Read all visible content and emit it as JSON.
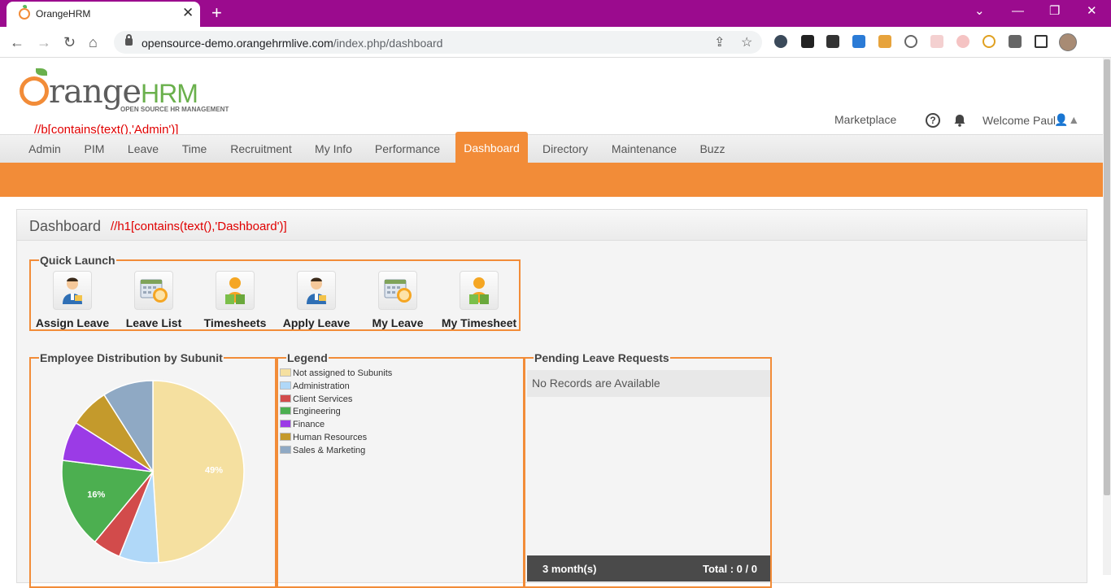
{
  "browser": {
    "tab_title": "OrangeHRM",
    "url_host": "opensource-demo.orangehrmlive.com",
    "url_path": "/index.php/dashboard",
    "tab_close": "✕",
    "new_tab": "+",
    "window_controls": {
      "chevron": "⌄",
      "minimize": "—",
      "restore": "❐",
      "close": "✕"
    },
    "nav_icons": {
      "back": "←",
      "forward": "→",
      "reload": "↻",
      "home": "⌂"
    },
    "url_icons": {
      "share": "⇪",
      "bookmark": "☆"
    }
  },
  "header": {
    "logo_main": "range",
    "logo_hrm": "HRM",
    "logo_tagline": "OPEN SOURCE HR MANAGEMENT",
    "xpath_admin": "//b[contains(text(),'Admin')]",
    "marketplace": "Marketplace",
    "help": "?",
    "welcome": "Welcome Paul",
    "user_glyph": "👤▲"
  },
  "menu": {
    "items": [
      {
        "label": "Admin"
      },
      {
        "label": "PIM"
      },
      {
        "label": "Leave"
      },
      {
        "label": "Time"
      },
      {
        "label": "Recruitment"
      },
      {
        "label": "My Info"
      },
      {
        "label": "Performance"
      },
      {
        "label": "Dashboard"
      },
      {
        "label": "Directory"
      },
      {
        "label": "Maintenance"
      },
      {
        "label": "Buzz"
      }
    ],
    "active": "Dashboard"
  },
  "dashboard": {
    "title": "Dashboard",
    "xpath_dashboard": "//h1[contains(text(),'Dashboard')]",
    "quick_launch": {
      "title": "Quick Launch",
      "items": [
        {
          "label": "Assign Leave",
          "icon": "person-icon"
        },
        {
          "label": "Leave List",
          "icon": "calendar-clock-icon"
        },
        {
          "label": "Timesheets",
          "icon": "person-book-icon"
        },
        {
          "label": "Apply Leave",
          "icon": "person-icon"
        },
        {
          "label": "My Leave",
          "icon": "calendar-clock-icon"
        },
        {
          "label": "My Timesheet",
          "icon": "person-book-icon"
        }
      ]
    },
    "distribution": {
      "title": "Employee Distribution by Subunit"
    },
    "legend": {
      "title": "Legend"
    },
    "pending": {
      "title": "Pending Leave Requests",
      "empty": "No Records are Available",
      "period": "3 month(s)",
      "total": "Total : 0 / 0"
    }
  },
  "chart_data": {
    "type": "pie",
    "title": "Employee Distribution by Subunit",
    "slices": [
      {
        "label": "Not assigned to Subunits",
        "value": 49,
        "color": "#f5e0a0",
        "value_label": "49%"
      },
      {
        "label": "Administration",
        "value": 7,
        "color": "#b0d8f8",
        "value_label": ""
      },
      {
        "label": "Client Services",
        "value": 5,
        "color": "#d24b4b",
        "value_label": ""
      },
      {
        "label": "Engineering",
        "value": 16,
        "color": "#4caf50",
        "value_label": "16%"
      },
      {
        "label": "Finance",
        "value": 7,
        "color": "#9b3be6",
        "value_label": ""
      },
      {
        "label": "Human Resources",
        "value": 7,
        "color": "#c49a2c",
        "value_label": ""
      },
      {
        "label": "Sales & Marketing",
        "value": 9,
        "color": "#8fa9c4",
        "value_label": ""
      }
    ],
    "legend_placement": "right"
  },
  "colors": {
    "brand_orange": "#f28c38",
    "tab_bar": "#9b0b8e"
  }
}
